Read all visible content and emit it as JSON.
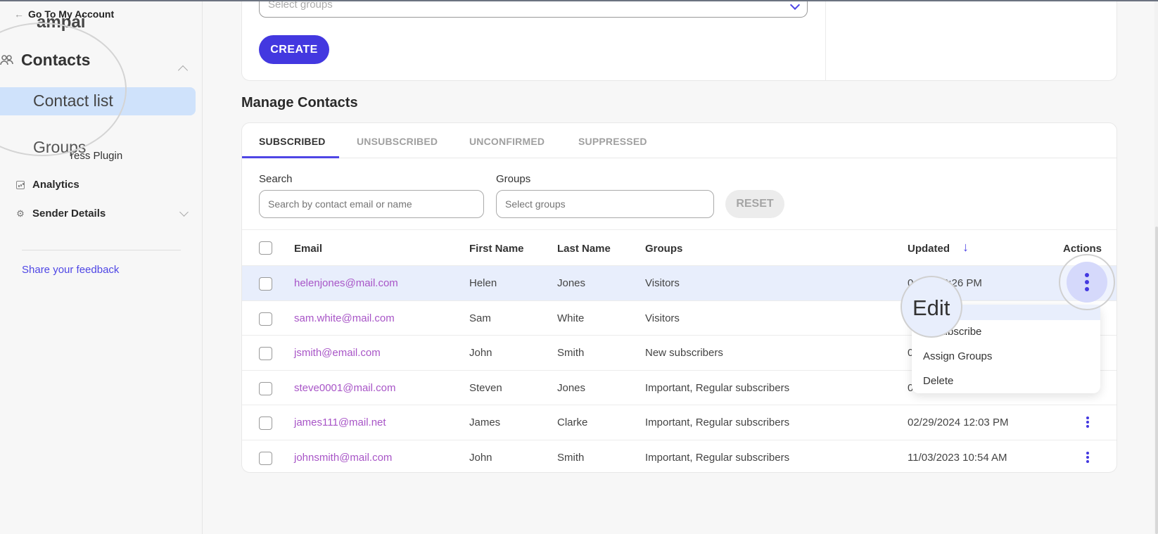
{
  "sidebar": {
    "back_link": "Go To My Account",
    "campaigns_peek": "ampai",
    "contacts_label": "Contacts",
    "contact_list_label": "Contact list",
    "groups_label": "Groups",
    "plugin_label": "ress Plugin",
    "analytics_label": "Analytics",
    "sender_details_label": "Sender Details",
    "feedback_link": "Share your feedback"
  },
  "top_form": {
    "groups_placeholder": "Select groups",
    "create_label": "CREATE"
  },
  "section_title": "Manage Contacts",
  "tabs": [
    {
      "label": "SUBSCRIBED",
      "active": true
    },
    {
      "label": "UNSUBSCRIBED",
      "active": false
    },
    {
      "label": "UNCONFIRMED",
      "active": false
    },
    {
      "label": "SUPPRESSED",
      "active": false
    }
  ],
  "filters": {
    "search_label": "Search",
    "search_placeholder": "Search by contact email or name",
    "groups_label": "Groups",
    "groups_placeholder": "Select groups",
    "reset_label": "RESET"
  },
  "table": {
    "columns": [
      "Email",
      "First Name",
      "Last Name",
      "Groups",
      "Updated",
      "Actions"
    ],
    "sort_icon": "arrow-down",
    "rows": [
      {
        "email": "helenjones@mail.com",
        "first": "Helen",
        "last": "Jones",
        "groups": "Visitors",
        "updated": "0     024 02:26 PM"
      },
      {
        "email": "sam.white@mail.com",
        "first": "Sam",
        "last": "White",
        "groups": "Visitors",
        "updated": ""
      },
      {
        "email": "jsmith@email.com",
        "first": "John",
        "last": "Smith",
        "groups": "New subscribers",
        "updated": "0"
      },
      {
        "email": "steve0001@mail.com",
        "first": "Steven",
        "last": "Jones",
        "groups": "Important, Regular subscribers",
        "updated": "0"
      },
      {
        "email": "james111@mail.net",
        "first": "James",
        "last": "Clarke",
        "groups": "Important, Regular subscribers",
        "updated": "02/29/2024 12:03 PM"
      },
      {
        "email": "johnsmith@mail.com",
        "first": "John",
        "last": "Smith",
        "groups": "Important, Regular subscribers",
        "updated": "11/03/2023 10:54 AM"
      }
    ]
  },
  "actions_menu": {
    "items": [
      "Edit",
      "Unsubscribe",
      "Assign Groups",
      "Delete"
    ],
    "unsubscribe_visible": "subscribe"
  },
  "colors": {
    "accent": "#4338e0",
    "email_link": "#a855c7",
    "row_highlight": "#e8eefc",
    "sidebar_active": "#cfe2fb"
  }
}
